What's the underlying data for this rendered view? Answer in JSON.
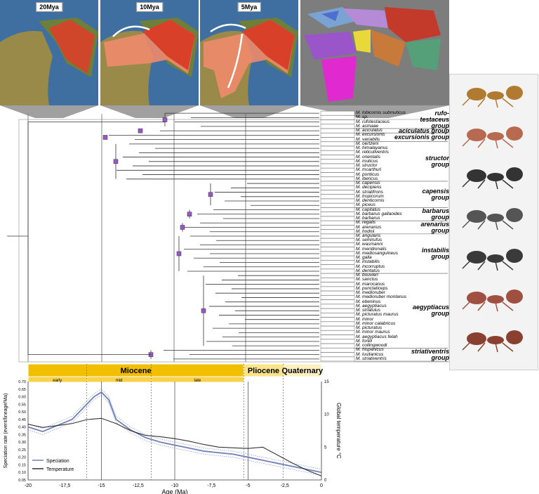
{
  "maps": [
    {
      "label": "20Mya"
    },
    {
      "label": "10Mya"
    },
    {
      "label": "5Mya"
    },
    {
      "label": ""
    }
  ],
  "species": [
    "M. lobicornis submuticus",
    "M. sp.",
    "M. rufotestaceus",
    "M. asmaae",
    "M. aciculatus",
    "M. excursionis",
    "M. variabilis",
    "M. oertzeni",
    "M. himalayanus",
    "M. reticuliventris",
    "M. orientalis",
    "M. muticus",
    "M. structor",
    "M. mcarthuri",
    "M. ponticus",
    "M. ibericus",
    "M. capensis",
    "M. decipiens",
    "M. striatifrons",
    "M. tropicorum",
    "M. denticornis",
    "M. piceus",
    "M. capitatus",
    "M. barbarus gallaoides",
    "M. barbarus",
    "M. regalis",
    "M. arenarius",
    "M. hodnii",
    "M. angularis",
    "M. semirufus",
    "M. wasmanni",
    "M. meridionalis",
    "M. mediosanguineus",
    "M. galla",
    "M. instabilis",
    "M. incorruptus",
    "M. dentatus",
    "M. bouvieri",
    "M. sanctus",
    "M. marocanus",
    "M. punctaticeps",
    "M. medioruber",
    "M. medioruber montanus",
    "M. ebeninus",
    "M. aegyptiacus",
    "M. striatulus",
    "M. picturatus maurus",
    "M. minor",
    "M. minor calabricus",
    "M. picturatus",
    "M. minor maurus",
    "M. aegyptiacus felah",
    "M. foreli",
    "M. collingwoodi",
    "M. hispanicus",
    "M. lusitanicus",
    "M. striativentris"
  ],
  "groups": [
    {
      "name": "rufo-\ntestaceus\ngroup"
    },
    {
      "name": "aciculatus group"
    },
    {
      "name": "excursionis group"
    },
    {
      "name": "structor\ngroup"
    },
    {
      "name": "capensis\ngroup"
    },
    {
      "name": "barbarus\ngroup"
    },
    {
      "name": "arenarius\ngroup"
    },
    {
      "name": "instabilis\ngroup"
    },
    {
      "name": "aegyptiacus\ngroup"
    },
    {
      "name": "striativentris\ngroup"
    }
  ],
  "epochs": [
    {
      "name": "Miocene",
      "start": -20,
      "end": -5.3
    },
    {
      "name": "Pliocene",
      "start": -5.3,
      "end": -2.6
    },
    {
      "name": "Quaternary",
      "start": -2.6,
      "end": 0
    }
  ],
  "subepochs": [
    {
      "name": "early",
      "start": -20,
      "end": -16
    },
    {
      "name": "mid",
      "start": -16,
      "end": -11.6
    },
    {
      "name": "late",
      "start": -11.6,
      "end": -5.3
    }
  ],
  "chart_data": {
    "type": "line",
    "xlabel": "Age (Ma)",
    "ylabel": "Speciation rate (event/lineage/Ma)",
    "y2label": "Global temperature °C",
    "xlim": [
      -20,
      0
    ],
    "ylim": [
      0.05,
      0.7
    ],
    "y2lim": [
      0,
      15
    ],
    "xticks": [
      -20,
      -17.5,
      -15,
      -12.5,
      -10,
      -7.5,
      -5,
      -2.5,
      0
    ],
    "xtick_labels": [
      "-20",
      "-17,5",
      "-15",
      "-12,5",
      "-10",
      "-7,5",
      "-5",
      "-2,5",
      "0"
    ],
    "yticks": [
      0.05,
      0.1,
      0.15,
      0.2,
      0.25,
      0.3,
      0.35,
      0.4,
      0.45,
      0.5,
      0.55,
      0.6,
      0.65,
      0.7
    ],
    "ytick_labels": [
      "0.05",
      "0.10",
      "0.15",
      "0.20",
      "0.25",
      "0.30",
      "0.35",
      "0.40",
      "0.45",
      "0.50",
      "0.55",
      "0.60",
      "0.65",
      "0.70"
    ],
    "y2ticks": [
      0,
      5,
      10,
      15
    ],
    "legend_position": "bottom-left",
    "series": [
      {
        "name": "Speciation",
        "axis": "left",
        "color": "#7080b8",
        "x": [
          -20,
          -19,
          -18,
          -17,
          -16.5,
          -16,
          -15.5,
          -15,
          -14.5,
          -14,
          -13,
          -12,
          -11,
          -10,
          -9,
          -8,
          -7,
          -6,
          -5,
          -4,
          -3,
          -2,
          -1,
          0
        ],
        "y": [
          0.4,
          0.37,
          0.41,
          0.45,
          0.5,
          0.55,
          0.6,
          0.63,
          0.58,
          0.45,
          0.38,
          0.33,
          0.3,
          0.28,
          0.26,
          0.24,
          0.23,
          0.22,
          0.2,
          0.18,
          0.16,
          0.14,
          0.12,
          0.1
        ]
      },
      {
        "name": "Temperature",
        "axis": "right",
        "color": "#333333",
        "x": [
          -20,
          -19,
          -18,
          -17,
          -16,
          -15,
          -14,
          -13,
          -12,
          -11,
          -10,
          -9,
          -8,
          -7,
          -6,
          -5,
          -4,
          -3,
          -2,
          -1,
          0
        ],
        "y": [
          8.5,
          8.0,
          8.3,
          8.6,
          9.2,
          9.4,
          8.6,
          7.5,
          6.8,
          6.6,
          6.3,
          5.9,
          5.4,
          5.0,
          4.9,
          4.8,
          5.0,
          3.8,
          2.6,
          1.5,
          0.6
        ]
      }
    ]
  }
}
